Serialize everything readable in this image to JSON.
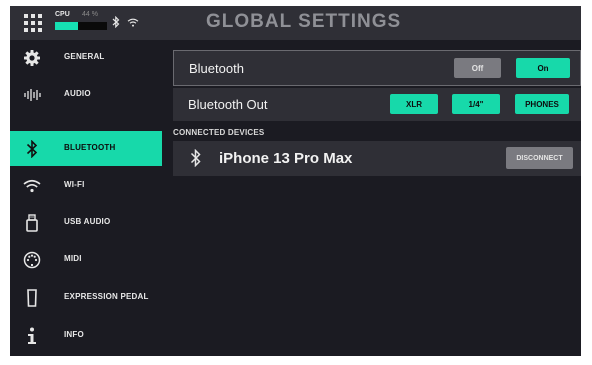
{
  "top_bar": {
    "title": "GLOBAL SETTINGS",
    "cpu_label": "CPU",
    "cpu_percent_text": "44 %",
    "cpu_level": 0.44
  },
  "sidebar": {
    "items": [
      {
        "label": "GENERAL",
        "icon": "gear-icon",
        "active": false
      },
      {
        "label": "AUDIO",
        "icon": "waveform-icon",
        "active": false
      },
      {
        "label": "BLUETOOTH",
        "icon": "bluetooth-icon",
        "active": true
      },
      {
        "label": "WI-FI",
        "icon": "wifi-icon",
        "active": false
      },
      {
        "label": "USB AUDIO",
        "icon": "usb-icon",
        "active": false
      },
      {
        "label": "MIDI",
        "icon": "midi-icon",
        "active": false
      },
      {
        "label": "EXPRESSION PEDAL",
        "icon": "pedal-icon",
        "active": false
      },
      {
        "label": "INFO",
        "icon": "info-icon",
        "active": false
      }
    ]
  },
  "bluetooth": {
    "label": "Bluetooth",
    "off_label": "Off",
    "on_label": "On",
    "selected": "On"
  },
  "bluetooth_out": {
    "label": "Bluetooth Out",
    "options": [
      "XLR",
      "1/4\"",
      "PHONES"
    ]
  },
  "connected_devices": {
    "section_label": "CONNECTED DEVICES",
    "devices": [
      {
        "name": "iPhone 13 Pro Max",
        "action_label": "DISCONNECT"
      }
    ]
  },
  "colors": {
    "accent": "#17d9aa",
    "background": "#1b1b22",
    "panel": "#2f2f36",
    "button_gray": "#7a7a80"
  }
}
